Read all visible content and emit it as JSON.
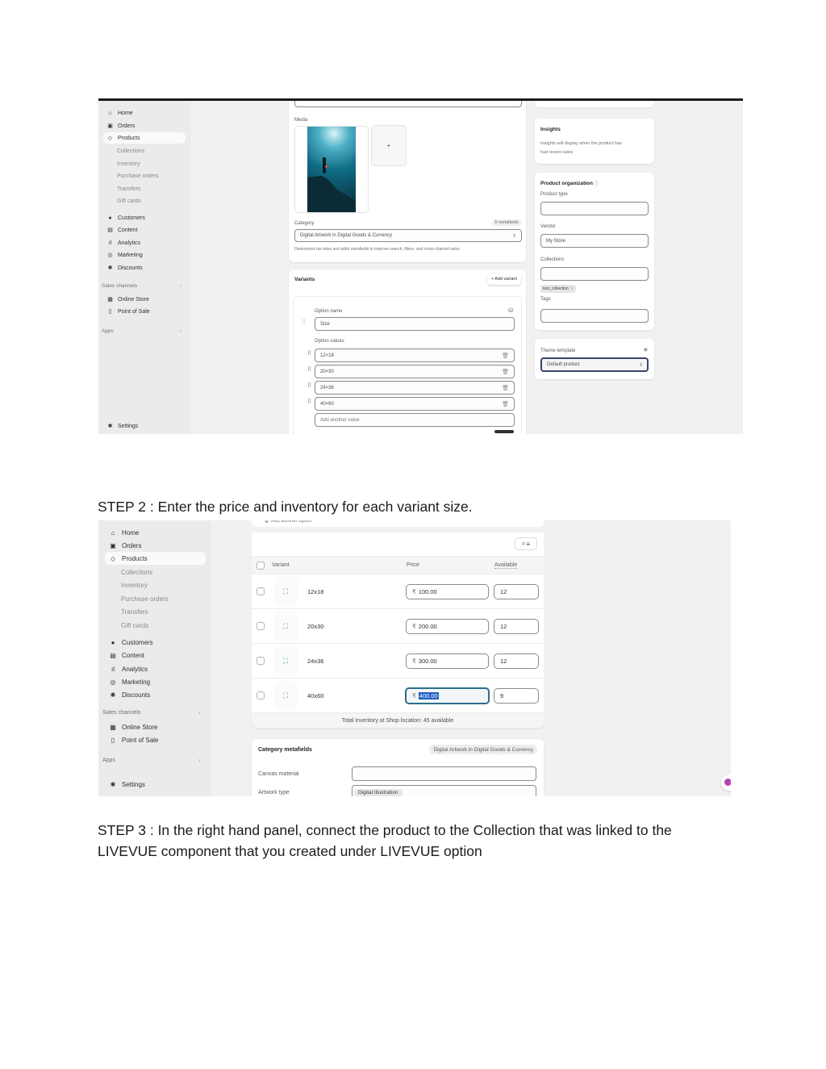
{
  "steps": {
    "step2": "STEP 2 : Enter the price and inventory  for each variant size.",
    "step3_line1": "STEP 3 : In the right hand panel, connect the product to the Collection that was linked to  the",
    "step3_line2": "LIVEVUE component that you created under LIVEVUE option"
  },
  "sidebar": {
    "home": "Home",
    "orders": "Orders",
    "products": "Products",
    "collections": "Collections",
    "inventory": "Inventory",
    "purchase_orders": "Purchase orders",
    "transfers": "Transfers",
    "gift_cards": "Gift cards",
    "customers": "Customers",
    "content": "Content",
    "analytics": "Analytics",
    "marketing": "Marketing",
    "discounts": "Discounts",
    "sales_channels": "Sales channels",
    "online_store": "Online Store",
    "point_of_sale": "Point of Sale",
    "apps": "Apps",
    "settings": "Settings"
  },
  "screenshot1": {
    "media_label": "Media",
    "add_media": "+",
    "category_label": "Category",
    "metafields_badge": "5 metafields",
    "category_value": "Digital Artwork in Digital Goods & Currency",
    "category_hint": "Determines tax rates and adds metafields to improve search, filters, and cross-channel sales",
    "variants_title": "Variants",
    "add_variant": "+ Add variant",
    "option_name_label": "Option name",
    "option_name_value": "Size",
    "option_values_label": "Option values",
    "option_values": [
      "12×18",
      "20×30",
      "24×36",
      "40×60"
    ],
    "add_value_placeholder": "Add another value",
    "insights_title": "Insights",
    "insights_text_1": "Insights will display when the product has",
    "insights_text_2": "had recent sales",
    "org_title": "Product organization",
    "product_type_label": "Product type",
    "product_type_value": "",
    "vendor_label": "Vendor",
    "vendor_value": "My Store",
    "collections_label": "Collections",
    "collection_tag": "test_collection",
    "tags_label": "Tags",
    "theme_label": "Theme template",
    "theme_value": "Default product"
  },
  "screenshot2": {
    "add_option": "Add another option",
    "headers": {
      "variant": "Variant",
      "price": "Price",
      "available": "Available"
    },
    "currency_symbol": "₹",
    "variants": [
      {
        "name": "12x18",
        "price": "100.00",
        "available": "12"
      },
      {
        "name": "20x30",
        "price": "200.00",
        "available": "12"
      },
      {
        "name": "24x36",
        "price": "300.00",
        "available": "12"
      },
      {
        "name": "40x60",
        "price": "400.00",
        "available": "9"
      }
    ],
    "total_inventory": "Total inventory at Shop location: 45 available",
    "metafields_title": "Category metafields",
    "metafields_badge": "Digital Artwork in Digital Goods & Currency",
    "canvas_label": "Canvas material",
    "canvas_value": "",
    "artwork_label": "Artwork type",
    "artwork_value": "Digital Illustration"
  }
}
